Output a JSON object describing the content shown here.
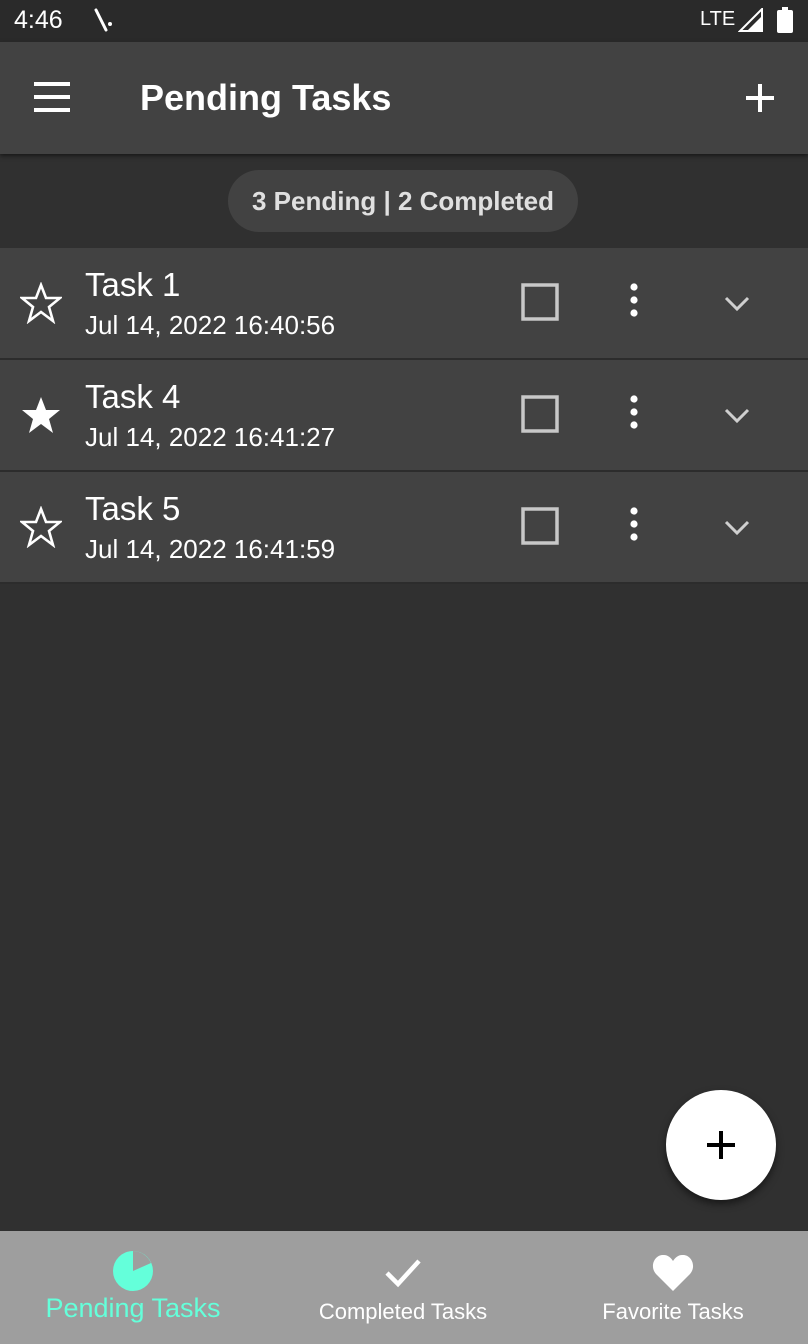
{
  "status_bar": {
    "time": "4:46",
    "network": "LTE"
  },
  "app_bar": {
    "title": "Pending Tasks"
  },
  "summary": {
    "text": "3 Pending | 2 Completed"
  },
  "tasks": [
    {
      "title": "Task 1",
      "date": "Jul 14, 2022 16:40:56",
      "favorite": false,
      "completed": false
    },
    {
      "title": "Task 4",
      "date": "Jul 14, 2022 16:41:27",
      "favorite": true,
      "completed": false
    },
    {
      "title": "Task 5",
      "date": "Jul 14, 2022 16:41:59",
      "favorite": false,
      "completed": false
    }
  ],
  "bottom_nav": {
    "items": [
      {
        "label": "Pending Tasks",
        "icon": "pie-chart-icon",
        "active": true
      },
      {
        "label": "Completed Tasks",
        "icon": "check-icon",
        "active": false
      },
      {
        "label": "Favorite Tasks",
        "icon": "heart-icon",
        "active": false
      }
    ]
  },
  "colors": {
    "background": "#303030",
    "surface": "#424242",
    "accent": "#64ffda",
    "bottom_nav": "#9e9e9e"
  }
}
